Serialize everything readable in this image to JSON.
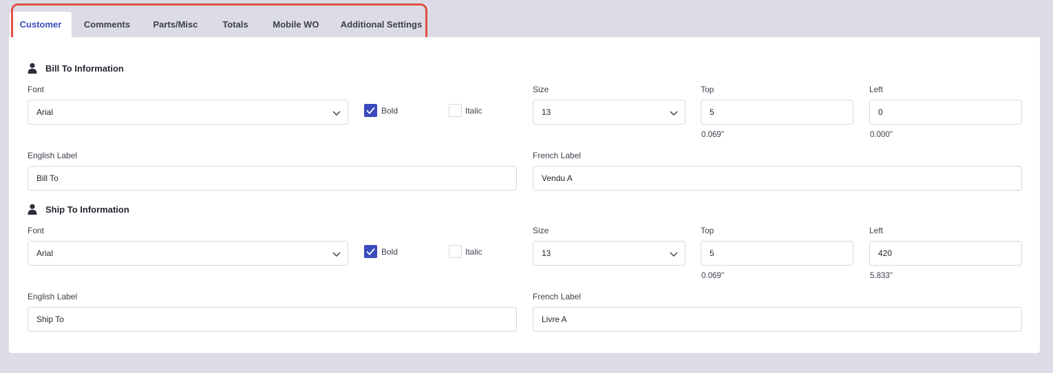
{
  "tabs": [
    {
      "label": "Customer",
      "active": true
    },
    {
      "label": "Comments",
      "active": false
    },
    {
      "label": "Parts/Misc",
      "active": false
    },
    {
      "label": "Totals",
      "active": false
    },
    {
      "label": "Mobile WO",
      "active": false
    },
    {
      "label": "Additional Settings",
      "active": false
    }
  ],
  "colors": {
    "accent": "#3a4bbd",
    "highlight": "#e0503f",
    "background": "#dcdce6"
  },
  "bill_to": {
    "title": "Bill To Information",
    "icon": "user-icon",
    "font_label": "Font",
    "font_value": "Arial",
    "bold_label": "Bold",
    "bold_checked": true,
    "italic_label": "Italic",
    "italic_checked": false,
    "size_label": "Size",
    "size_value": "13",
    "top_label": "Top",
    "top_value": "5",
    "top_inches": "0.069''",
    "left_label": "Left",
    "left_value": "0",
    "left_inches": "0.000''",
    "english_label_label": "English Label",
    "english_label_value": "Bill To",
    "french_label_label": "French Label",
    "french_label_value": "Vendu A"
  },
  "ship_to": {
    "title": "Ship To Information",
    "icon": "user-icon",
    "font_label": "Font",
    "font_value": "Arial",
    "bold_label": "Bold",
    "bold_checked": true,
    "italic_label": "Italic",
    "italic_checked": false,
    "size_label": "Size",
    "size_value": "13",
    "top_label": "Top",
    "top_value": "5",
    "top_inches": "0.069''",
    "left_label": "Left",
    "left_value": "420",
    "left_inches": "5.833''",
    "english_label_label": "English Label",
    "english_label_value": "Ship To",
    "french_label_label": "French Label",
    "french_label_value": "Livre A"
  }
}
